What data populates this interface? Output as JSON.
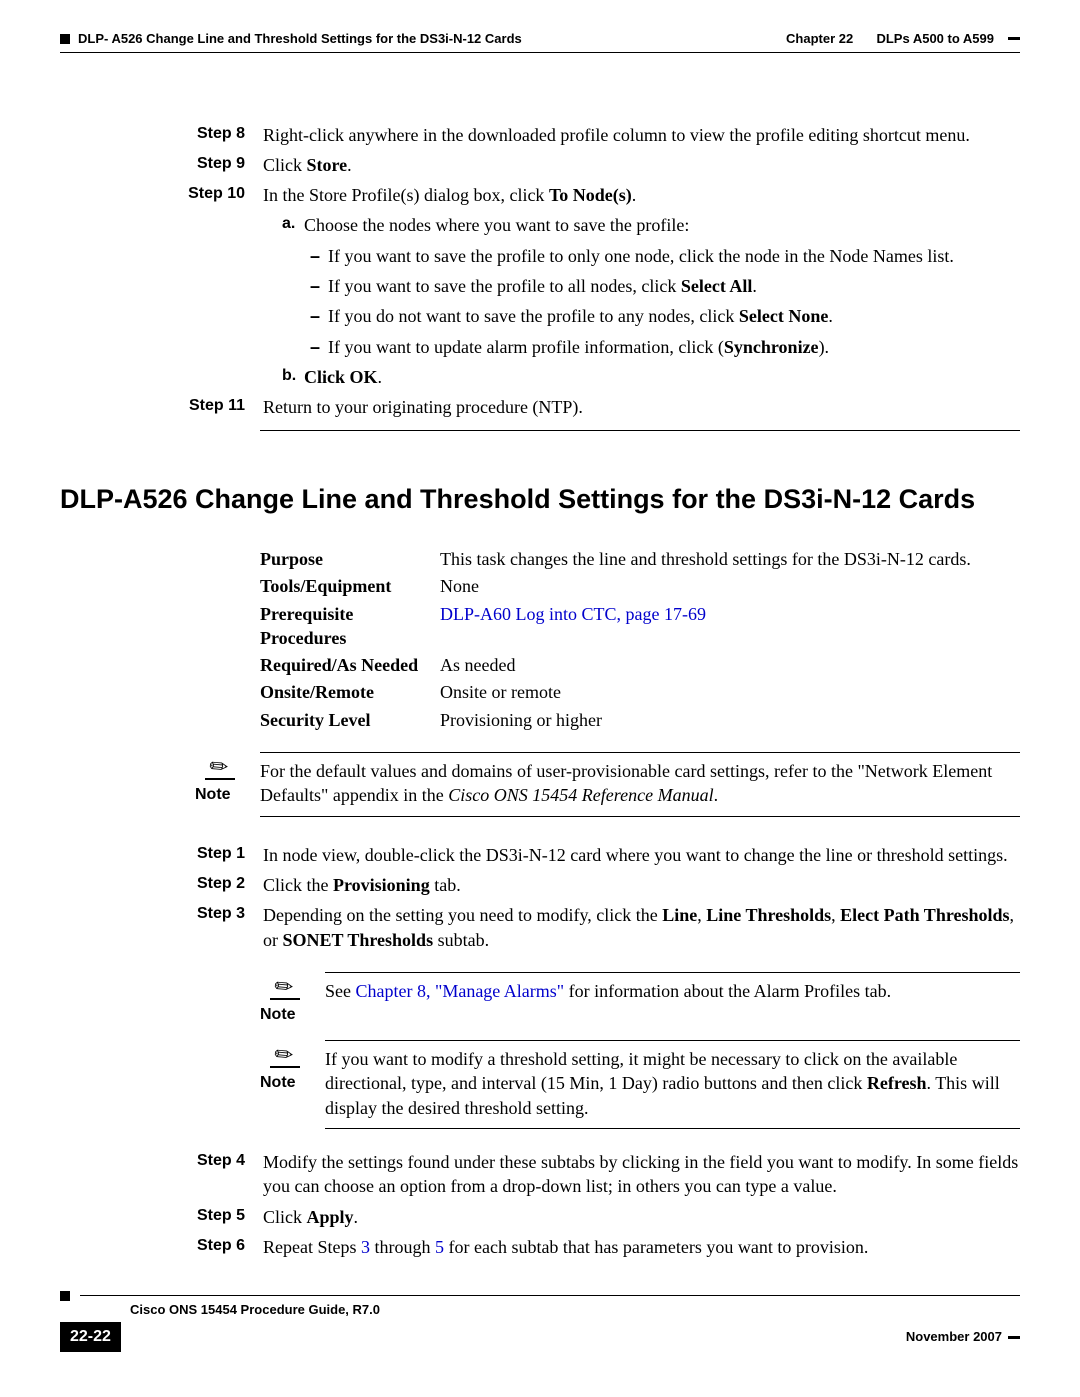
{
  "header": {
    "chapter": "Chapter 22",
    "chapter_title": "DLPs A500 to A599",
    "section_title": "DLP- A526 Change Line and Threshold Settings for the DS3i-N-12 Cards"
  },
  "steps_top": {
    "s8": {
      "label": "Step 8",
      "text": "Right-click anywhere in the downloaded profile column to view the profile editing shortcut menu."
    },
    "s9": {
      "label": "Step 9",
      "pre": "Click ",
      "bold": "Store",
      "post": "."
    },
    "s10": {
      "label": "Step 10",
      "pre": "In the Store Profile(s) dialog box, click ",
      "bold": "To Node(s)",
      "post": ".",
      "a": {
        "label": "a.",
        "text": "Choose the nodes where you want to save the profile:"
      },
      "d1": "If you want to save the profile to only one node, click the node in the Node Names list.",
      "d2_pre": "If you want to save the profile to all nodes, click ",
      "d2_bold": "Select All",
      "d2_post": ".",
      "d3_pre": "If you do not want to save the profile to any nodes, click ",
      "d3_bold": "Select None",
      "d3_post": ".",
      "d4_pre": "If you want to update alarm profile information, click (",
      "d4_bold": "Synchronize",
      "d4_post": ").",
      "b": {
        "label": "b.",
        "bold": "Click OK",
        "post": "."
      }
    },
    "s11": {
      "label": "Step 11",
      "text": "Return to your originating procedure (NTP)."
    }
  },
  "task": {
    "title": "DLP-A526 Change Line and Threshold Settings for the DS3i-N-12 Cards",
    "info": {
      "purpose_label": "Purpose",
      "purpose_value": "This task changes the line and threshold settings for the DS3i-N-12 cards.",
      "tools_label": "Tools/Equipment",
      "tools_value": "None",
      "prereq_label": "Prerequisite Procedures",
      "prereq_link": "DLP-A60 Log into CTC, page 17-69",
      "required_label": "Required/As Needed",
      "required_value": "As needed",
      "onsite_label": "Onsite/Remote",
      "onsite_value": "Onsite or remote",
      "security_label": "Security Level",
      "security_value": "Provisioning or higher"
    },
    "note1_label": "Note",
    "note1_pre": "For the default values and domains of user-provisionable card settings, refer to the \"Network Element Defaults\" appendix in the ",
    "note1_italic": "Cisco ONS 15454 Reference Manual",
    "note1_post": "."
  },
  "steps_bottom": {
    "s1": {
      "label": "Step 1",
      "text": "In node view, double-click the DS3i-N-12 card where you want to change the line or threshold settings."
    },
    "s2": {
      "label": "Step 2",
      "pre": "Click the ",
      "bold": "Provisioning",
      "post": " tab."
    },
    "s3": {
      "label": "Step 3",
      "pre": "Depending on the setting you need to modify, click the ",
      "b1": "Line",
      "c1": ", ",
      "b2": "Line Thresholds",
      "c2": ", ",
      "b3": "Elect Path Thresholds",
      "c3": ", or ",
      "b4": "SONET Thresholds",
      "post": " subtab."
    },
    "note2_label": "Note",
    "note2_pre": "See ",
    "note2_link": "Chapter 8, \"Manage Alarms\"",
    "note2_post": " for information about the Alarm Profiles tab.",
    "note3_label": "Note",
    "note3_pre": "If you want to modify a threshold setting, it might be necessary to click on the available directional, type, and interval (15 Min, 1 Day) radio buttons and then click ",
    "note3_bold": "Refresh",
    "note3_post": ". This will display the desired threshold setting.",
    "s4": {
      "label": "Step 4",
      "text": "Modify the settings found under these subtabs by clicking in the field you want to modify. In some fields you can choose an option from a drop-down list; in others you can type a value."
    },
    "s5": {
      "label": "Step 5",
      "pre": "Click ",
      "bold": "Apply",
      "post": "."
    },
    "s6": {
      "label": "Step 6",
      "pre": "Repeat Steps ",
      "l1": "3",
      "mid": " through ",
      "l2": "5",
      "post": " for each subtab that has parameters you want to provision."
    }
  },
  "footer": {
    "guide": "Cisco ONS 15454 Procedure Guide, R7.0",
    "page": "22-22",
    "date": "November 2007"
  }
}
